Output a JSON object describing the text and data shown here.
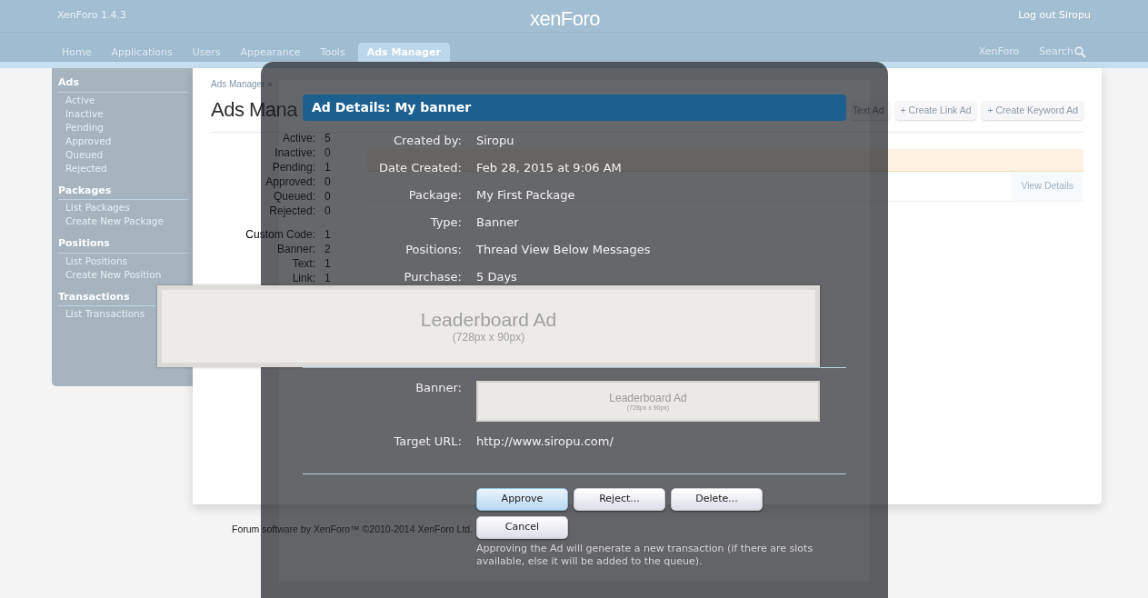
{
  "header": {
    "version": "XenForo 1.4.3",
    "logo": "xenForo",
    "logout": "Log out Siropu"
  },
  "nav": {
    "tabs": [
      {
        "label": "Home",
        "selected": false
      },
      {
        "label": "Applications",
        "selected": false
      },
      {
        "label": "Users",
        "selected": false
      },
      {
        "label": "Appearance",
        "selected": false
      },
      {
        "label": "Tools",
        "selected": false
      },
      {
        "label": "Ads Manager",
        "selected": true
      }
    ],
    "right_links": [
      "XenForo",
      "Search"
    ]
  },
  "sidebar": {
    "sections": [
      {
        "heading": "Ads",
        "items": [
          "Active",
          "Inactive",
          "Pending",
          "Approved",
          "Queued",
          "Rejected"
        ]
      },
      {
        "heading": "Packages",
        "items": [
          "List Packages",
          "Create New Package"
        ]
      },
      {
        "heading": "Positions",
        "items": [
          "List Positions",
          "Create New Position"
        ]
      },
      {
        "heading": "Transactions",
        "items": [
          "List Transactions"
        ]
      }
    ]
  },
  "content": {
    "breadcrumb": "Ads Manager »",
    "title": "Ads Mana",
    "actions": [
      "Text Ad",
      "+ Create Link Ad",
      "+ Create Keyword Ad"
    ],
    "row_action": "View Details",
    "status_stats": [
      {
        "label": "Active:",
        "value": "5"
      },
      {
        "label": "Inactive:",
        "value": "0"
      },
      {
        "label": "Pending:",
        "value": "1"
      },
      {
        "label": "Approved:",
        "value": "0"
      },
      {
        "label": "Queued:",
        "value": "0"
      },
      {
        "label": "Rejected:",
        "value": "0"
      }
    ],
    "type_stats": [
      {
        "label": "Custom Code:",
        "value": "1"
      },
      {
        "label": "Banner:",
        "value": "2"
      },
      {
        "label": "Text:",
        "value": "1"
      },
      {
        "label": "Link:",
        "value": "1"
      }
    ]
  },
  "footer": "Forum software by XenForo™ ©2010-2014 XenForo Ltd.",
  "modal": {
    "title": "Ad Details: My banner",
    "details": [
      {
        "kind": "text",
        "label": "Created by:",
        "value": "Siropu"
      },
      {
        "kind": "text",
        "label": "Date Created:",
        "value": "Feb 28, 2015 at 9:06 AM"
      },
      {
        "kind": "text",
        "label": "Package:",
        "value": "My First Package"
      },
      {
        "kind": "text",
        "label": "Type:",
        "value": "Banner"
      },
      {
        "kind": "text",
        "label": "Positions:",
        "value": "Thread View Below Messages"
      },
      {
        "kind": "text",
        "label": "Purchase:",
        "value": "5 Days"
      }
    ],
    "media": [
      {
        "kind": "banner",
        "label": "Banner:",
        "banner_title": "Leaderboard Ad",
        "banner_size": "(728px x 90px)"
      },
      {
        "kind": "text",
        "label": "Target URL:",
        "value": "http://www.siropu.com/"
      }
    ],
    "buttons": [
      {
        "label": "Approve",
        "selected": true
      },
      {
        "label": "Reject...",
        "selected": false
      },
      {
        "label": "Delete...",
        "selected": false
      }
    ],
    "cancel": "Cancel",
    "note": "Approving the Ad will generate a new transaction (if there are slots available, else it will be added to the queue)."
  },
  "preview": {
    "title": "Leaderboard Ad",
    "size": "(728px x 90px)"
  }
}
